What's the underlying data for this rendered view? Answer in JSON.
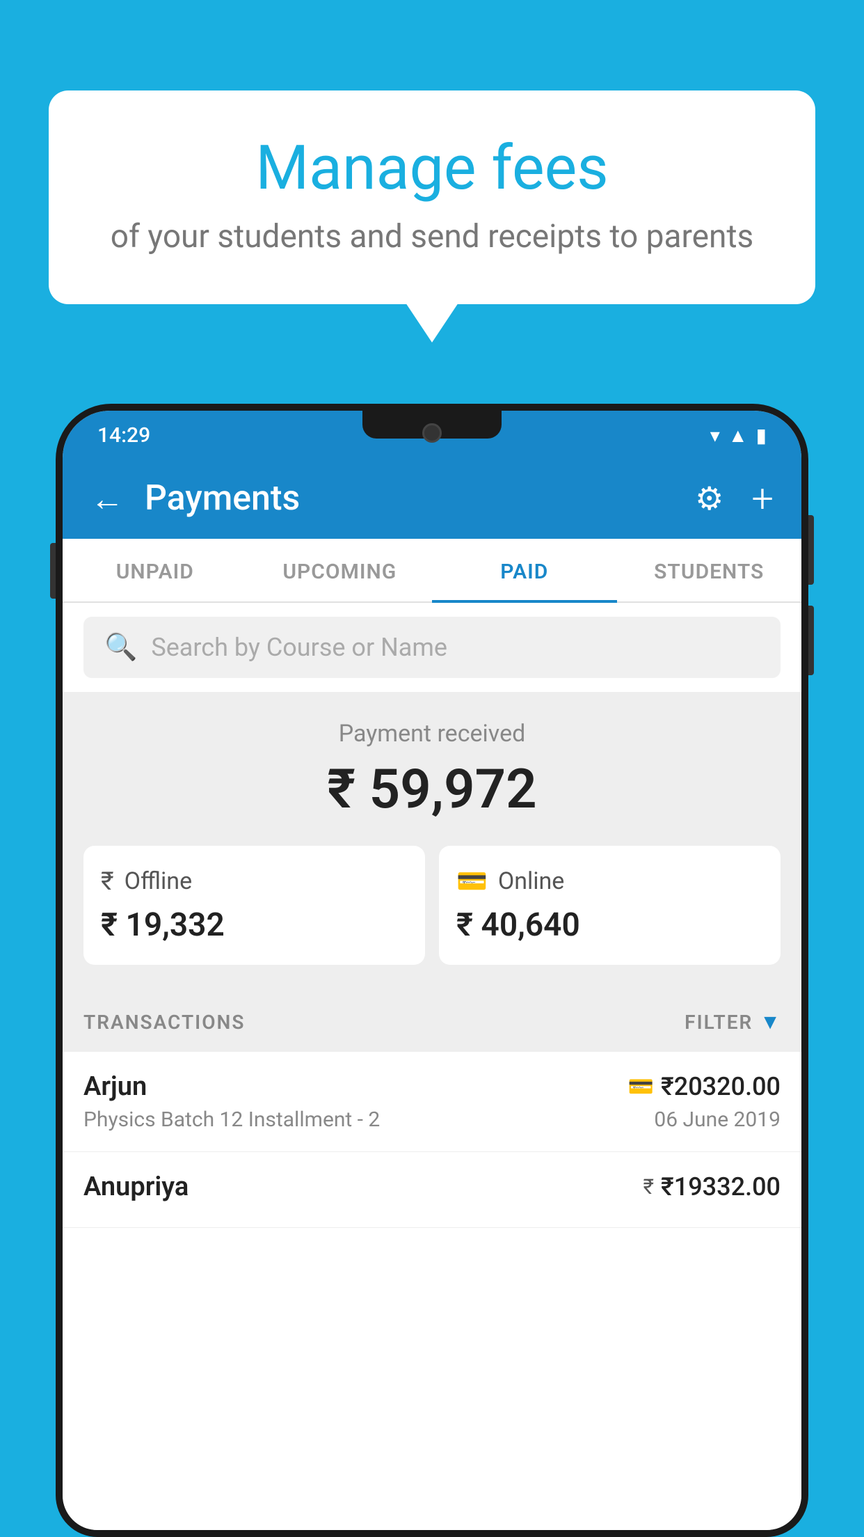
{
  "background_color": "#1AAFE0",
  "speech_bubble": {
    "title": "Manage fees",
    "subtitle": "of your students and send receipts to parents"
  },
  "phone": {
    "status_bar": {
      "time": "14:29"
    },
    "app_bar": {
      "title": "Payments",
      "back_label": "←",
      "gear_label": "⚙",
      "plus_label": "+"
    },
    "tabs": [
      {
        "label": "UNPAID",
        "active": false
      },
      {
        "label": "UPCOMING",
        "active": false
      },
      {
        "label": "PAID",
        "active": true
      },
      {
        "label": "STUDENTS",
        "active": false
      }
    ],
    "search": {
      "placeholder": "Search by Course or Name"
    },
    "payment_received": {
      "label": "Payment received",
      "amount": "₹ 59,972",
      "offline": {
        "icon": "rupee-offline",
        "type": "Offline",
        "amount": "₹ 19,332"
      },
      "online": {
        "icon": "card",
        "type": "Online",
        "amount": "₹ 40,640"
      }
    },
    "transactions_header": {
      "label": "TRANSACTIONS",
      "filter_label": "FILTER"
    },
    "transactions": [
      {
        "name": "Arjun",
        "course": "Physics Batch 12 Installment - 2",
        "amount": "₹20320.00",
        "date": "06 June 2019",
        "payment_type": "card"
      },
      {
        "name": "Anupriya",
        "course": "",
        "amount": "₹19332.00",
        "date": "",
        "payment_type": "rupee"
      }
    ]
  }
}
